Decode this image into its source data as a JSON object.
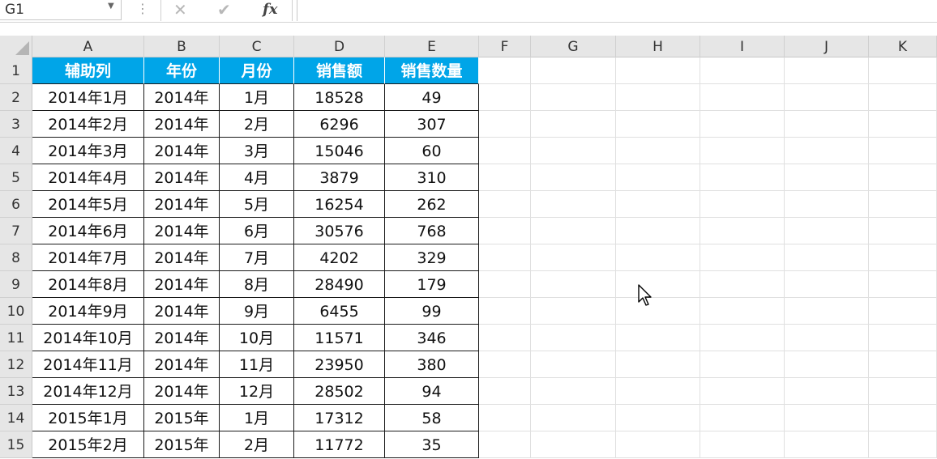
{
  "formula_bar": {
    "name_box": "G1",
    "cancel_icon": "✕",
    "enter_icon": "✔",
    "fx_label": "fx",
    "formula": ""
  },
  "columns": [
    "A",
    "B",
    "C",
    "D",
    "E",
    "F",
    "G",
    "H",
    "I",
    "J",
    "K"
  ],
  "row_numbers": [
    "1",
    "2",
    "3",
    "4",
    "5",
    "6",
    "7",
    "8",
    "9",
    "10",
    "11",
    "12",
    "13",
    "14",
    "15"
  ],
  "table": {
    "header": [
      "辅助列",
      "年份",
      "月份",
      "销售额",
      "销售数量"
    ],
    "rows": [
      [
        "2014年1月",
        "2014年",
        "1月",
        "18528",
        "49"
      ],
      [
        "2014年2月",
        "2014年",
        "2月",
        "6296",
        "307"
      ],
      [
        "2014年3月",
        "2014年",
        "3月",
        "15046",
        "60"
      ],
      [
        "2014年4月",
        "2014年",
        "4月",
        "3879",
        "310"
      ],
      [
        "2014年5月",
        "2014年",
        "5月",
        "16254",
        "262"
      ],
      [
        "2014年6月",
        "2014年",
        "6月",
        "30576",
        "768"
      ],
      [
        "2014年7月",
        "2014年",
        "7月",
        "4202",
        "329"
      ],
      [
        "2014年8月",
        "2014年",
        "8月",
        "28490",
        "179"
      ],
      [
        "2014年9月",
        "2014年",
        "9月",
        "6455",
        "99"
      ],
      [
        "2014年10月",
        "2014年",
        "10月",
        "11571",
        "346"
      ],
      [
        "2014年11月",
        "2014年",
        "11月",
        "23950",
        "380"
      ],
      [
        "2014年12月",
        "2014年",
        "12月",
        "28502",
        "94"
      ],
      [
        "2015年1月",
        "2015年",
        "1月",
        "17312",
        "58"
      ],
      [
        "2015年2月",
        "2015年",
        "2月",
        "11772",
        "35"
      ]
    ]
  },
  "colors": {
    "header_fill": "#00a5e8",
    "header_text": "#ffffff"
  }
}
